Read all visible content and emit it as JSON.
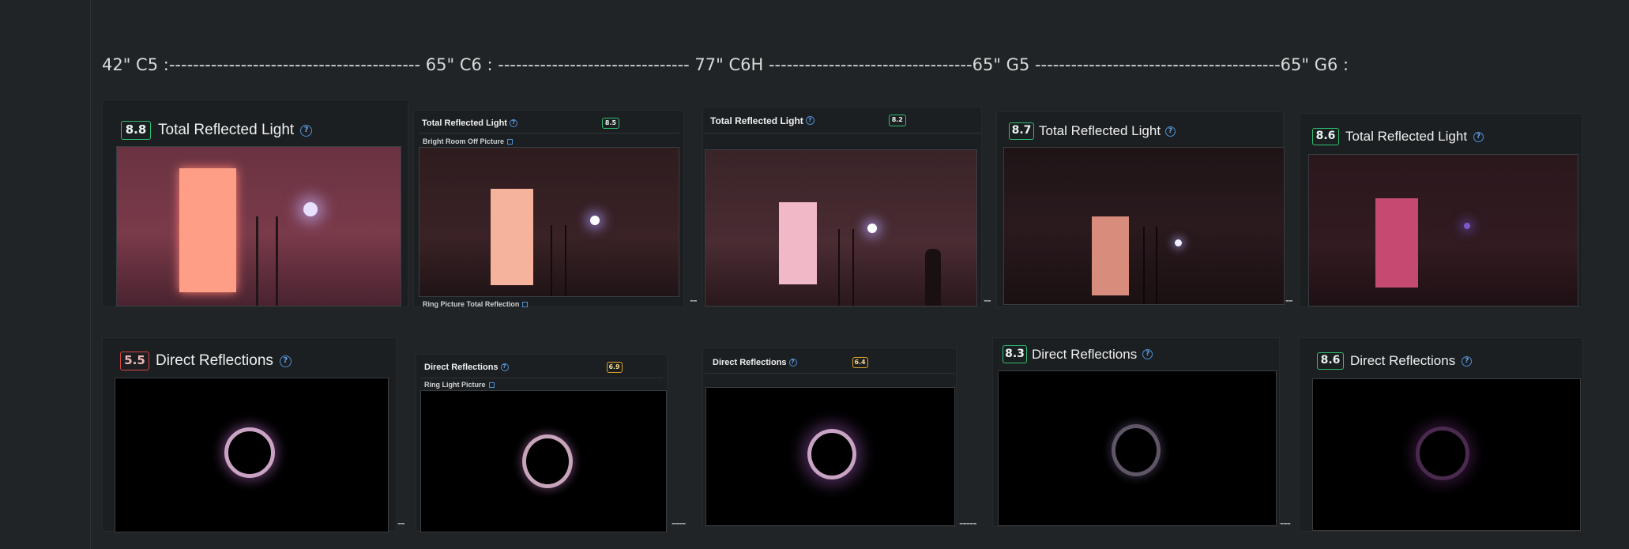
{
  "header": {
    "comparison_line": "42\" C5 :------------------------------------------ 65\" C6 : -------------------------------- 77\" C6H ----------------------------------65\" G5 -----------------------------------------65\" G6 :"
  },
  "total_reflected_light": {
    "title": "Total Reflected Light",
    "tvs": [
      {
        "model": "42\" C5",
        "score": "8.8"
      },
      {
        "model": "65\" C6",
        "score": "8.5",
        "sub_top": "Bright Room Off Picture",
        "sub_bottom": "Ring Picture Total Reflection"
      },
      {
        "model": "77\" C6H",
        "score": "8.2"
      },
      {
        "model": "65\" G5",
        "score": "8.7"
      },
      {
        "model": "65\" G6",
        "score": "8.6"
      }
    ]
  },
  "direct_reflections": {
    "title": "Direct Reflections",
    "tvs": [
      {
        "model": "42\" C5",
        "score": "5.5",
        "status": "red"
      },
      {
        "model": "65\" C6",
        "score": "6.9",
        "status": "amber",
        "sub_top": "Ring Light Picture"
      },
      {
        "model": "77\" C6H",
        "score": "6.4",
        "status": "amber"
      },
      {
        "model": "65\" G5",
        "score": "8.3",
        "status": "green"
      },
      {
        "model": "65\" G6",
        "score": "8.6",
        "status": "green"
      }
    ]
  },
  "separators": [
    "--",
    "--",
    "--",
    "--",
    "--",
    "----",
    "-----",
    "---"
  ],
  "help_glyph": "?",
  "icons": [
    "help-circle-icon",
    "info-square-icon"
  ],
  "colors": {
    "good": "#2fbf72",
    "bad": "#d64545",
    "mid": "#d9a026",
    "link": "#4d8fd8"
  }
}
